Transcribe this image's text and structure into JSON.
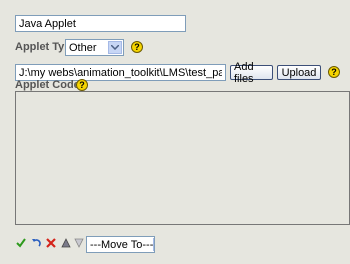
{
  "title_field": {
    "value": "Java Applet"
  },
  "applet_type": {
    "label": "Applet Type",
    "selected": "Other"
  },
  "file_path": {
    "value": "J:\\my webs\\animation_toolkit\\LMS\\test_package\\cloze"
  },
  "buttons": {
    "add_files": "Add files",
    "upload": "Upload"
  },
  "applet_code": {
    "label": "Applet Code:"
  },
  "move_to": {
    "selected": "---Move To---"
  },
  "help_glyph": "?"
}
